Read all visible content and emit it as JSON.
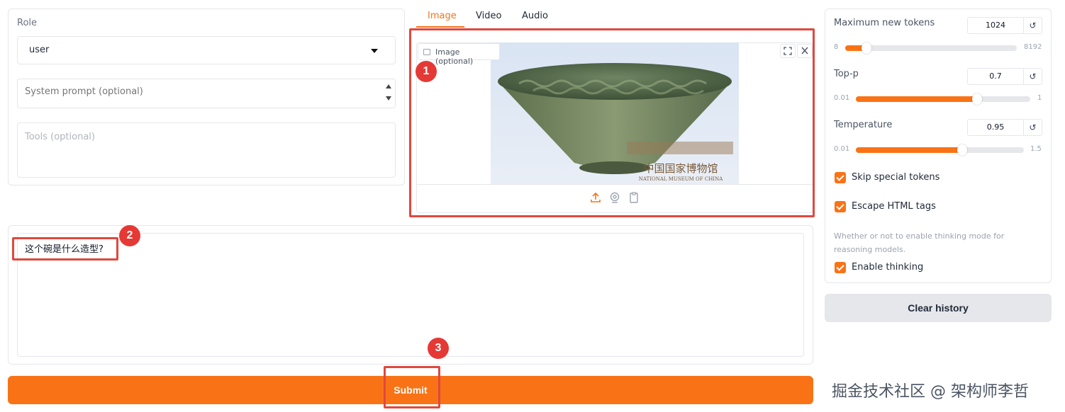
{
  "left": {
    "role_label": "Role",
    "role_value": "user",
    "system_placeholder": "System prompt (optional)",
    "tools_placeholder": "Tools (optional)"
  },
  "tabs": {
    "image": "Image",
    "video": "Video",
    "audio": "Audio"
  },
  "image_input": {
    "label": "Image (optional)",
    "preview_text_cn": "中国国家博物馆",
    "preview_text_en": "NATIONAL MUSEUM OF CHINA"
  },
  "badges": {
    "one": "1",
    "two": "2",
    "three": "3"
  },
  "message": {
    "text": "这个碗是什么造型?"
  },
  "submit_label": "Submit",
  "params": {
    "max_tokens": {
      "label": "Maximum new tokens",
      "value": "1024",
      "min": "8",
      "max": "8192",
      "fraction": 0.124
    },
    "top_p": {
      "label": "Top-p",
      "value": "0.7",
      "min": "0.01",
      "max": "1",
      "fraction": 0.697
    },
    "temperature": {
      "label": "Temperature",
      "value": "0.95",
      "min": "0.01",
      "max": "1.5",
      "fraction": 0.631
    }
  },
  "checkboxes": {
    "skip_special": "Skip special tokens",
    "escape_html": "Escape HTML tags",
    "thinking_info": "Whether or not to enable thinking mode for reasoning models.",
    "enable_thinking": "Enable thinking"
  },
  "reset_glyph": "↺",
  "clear_label": "Clear history",
  "watermark": "掘金技术社区 @ 架构师李哲",
  "colors": {
    "accent": "#f97316",
    "highlight": "#e0483e"
  }
}
